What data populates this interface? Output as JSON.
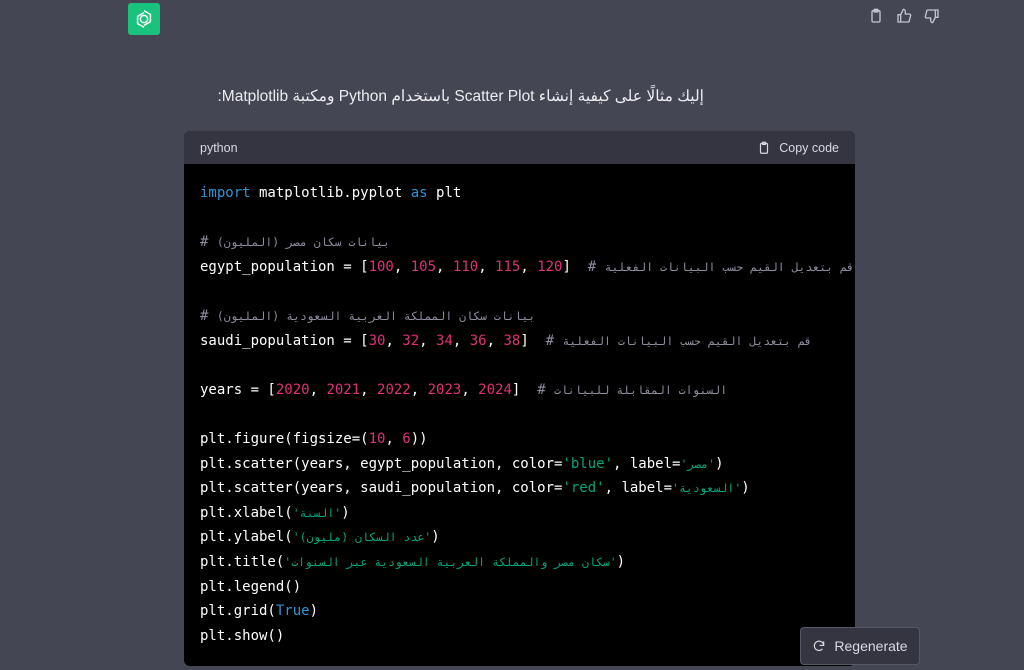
{
  "intro_text": "إليك مثالًا على كيفية إنشاء Scatter Plot باستخدام Python ومكتبة Matplotlib:",
  "code_block": {
    "language": "python",
    "copy_label": "Copy code",
    "lines": [
      [
        {
          "t": "import",
          "c": "kw"
        },
        {
          "t": " matplotlib.pyplot "
        },
        {
          "t": "as",
          "c": "kw"
        },
        {
          "t": " plt"
        }
      ],
      [],
      [
        {
          "t": "# ",
          "c": "cmt"
        },
        {
          "t": "بيانات سكان مصر (المليون)",
          "c": "cmt ar"
        }
      ],
      [
        {
          "t": "egypt_population = ["
        },
        {
          "t": "100",
          "c": "num"
        },
        {
          "t": ", "
        },
        {
          "t": "105",
          "c": "num"
        },
        {
          "t": ", "
        },
        {
          "t": "110",
          "c": "num"
        },
        {
          "t": ", "
        },
        {
          "t": "115",
          "c": "num"
        },
        {
          "t": ", "
        },
        {
          "t": "120",
          "c": "num"
        },
        {
          "t": "]  "
        },
        {
          "t": "# ",
          "c": "cmt"
        },
        {
          "t": "قم بتعديل القيم حسب البيانات الفعلية",
          "c": "cmt ar"
        }
      ],
      [],
      [
        {
          "t": "# ",
          "c": "cmt"
        },
        {
          "t": "بيانات سكان المملكة العربية السعودية (المليون)",
          "c": "cmt ar"
        }
      ],
      [
        {
          "t": "saudi_population = ["
        },
        {
          "t": "30",
          "c": "num"
        },
        {
          "t": ", "
        },
        {
          "t": "32",
          "c": "num"
        },
        {
          "t": ", "
        },
        {
          "t": "34",
          "c": "num"
        },
        {
          "t": ", "
        },
        {
          "t": "36",
          "c": "num"
        },
        {
          "t": ", "
        },
        {
          "t": "38",
          "c": "num"
        },
        {
          "t": "]  "
        },
        {
          "t": "# ",
          "c": "cmt"
        },
        {
          "t": "قم بتعديل القيم حسب البيانات الفعلية",
          "c": "cmt ar"
        }
      ],
      [],
      [
        {
          "t": "years = ["
        },
        {
          "t": "2020",
          "c": "num"
        },
        {
          "t": ", "
        },
        {
          "t": "2021",
          "c": "num"
        },
        {
          "t": ", "
        },
        {
          "t": "2022",
          "c": "num"
        },
        {
          "t": ", "
        },
        {
          "t": "2023",
          "c": "num"
        },
        {
          "t": ", "
        },
        {
          "t": "2024",
          "c": "num"
        },
        {
          "t": "]  "
        },
        {
          "t": "# ",
          "c": "cmt"
        },
        {
          "t": "السنوات المقابلة للبيانات",
          "c": "cmt ar"
        }
      ],
      [],
      [
        {
          "t": "plt.figure(figsize=("
        },
        {
          "t": "10",
          "c": "num"
        },
        {
          "t": ", "
        },
        {
          "t": "6",
          "c": "num"
        },
        {
          "t": "))"
        }
      ],
      [
        {
          "t": "plt.scatter(years, egypt_population, color="
        },
        {
          "t": "'blue'",
          "c": "str"
        },
        {
          "t": ", label="
        },
        {
          "t": "'مصر'",
          "c": "str ar"
        },
        {
          "t": ")"
        }
      ],
      [
        {
          "t": "plt.scatter(years, saudi_population, color="
        },
        {
          "t": "'red'",
          "c": "str"
        },
        {
          "t": ", label="
        },
        {
          "t": "'السعودية'",
          "c": "str ar"
        },
        {
          "t": ")"
        }
      ],
      [
        {
          "t": "plt.xlabel("
        },
        {
          "t": "'السنة'",
          "c": "str ar"
        },
        {
          "t": ")"
        }
      ],
      [
        {
          "t": "plt.ylabel("
        },
        {
          "t": "'عدد السكان (مليون)'",
          "c": "str ar"
        },
        {
          "t": ")"
        }
      ],
      [
        {
          "t": "plt.title("
        },
        {
          "t": "'سكان مصر والمملكة العربية السعودية عبر السنوات'",
          "c": "str ar"
        },
        {
          "t": ")"
        }
      ],
      [
        {
          "t": "plt.legend()"
        }
      ],
      [
        {
          "t": "plt.grid("
        },
        {
          "t": "True",
          "c": "kw"
        },
        {
          "t": ")"
        }
      ],
      [
        {
          "t": "plt.show()"
        }
      ]
    ]
  },
  "regenerate_label": "Regenerate",
  "icons": {
    "avatar": "openai-logo-icon",
    "copy": "clipboard-icon",
    "like": "thumbs-up-icon",
    "dislike": "thumbs-down-icon",
    "regenerate": "refresh-icon"
  },
  "colors": {
    "background": "#444654",
    "avatar": "#19c37d",
    "keyword": "#2e95d3",
    "number": "#df3079",
    "string": "#00a67d",
    "comment": "#8e8ea0"
  }
}
